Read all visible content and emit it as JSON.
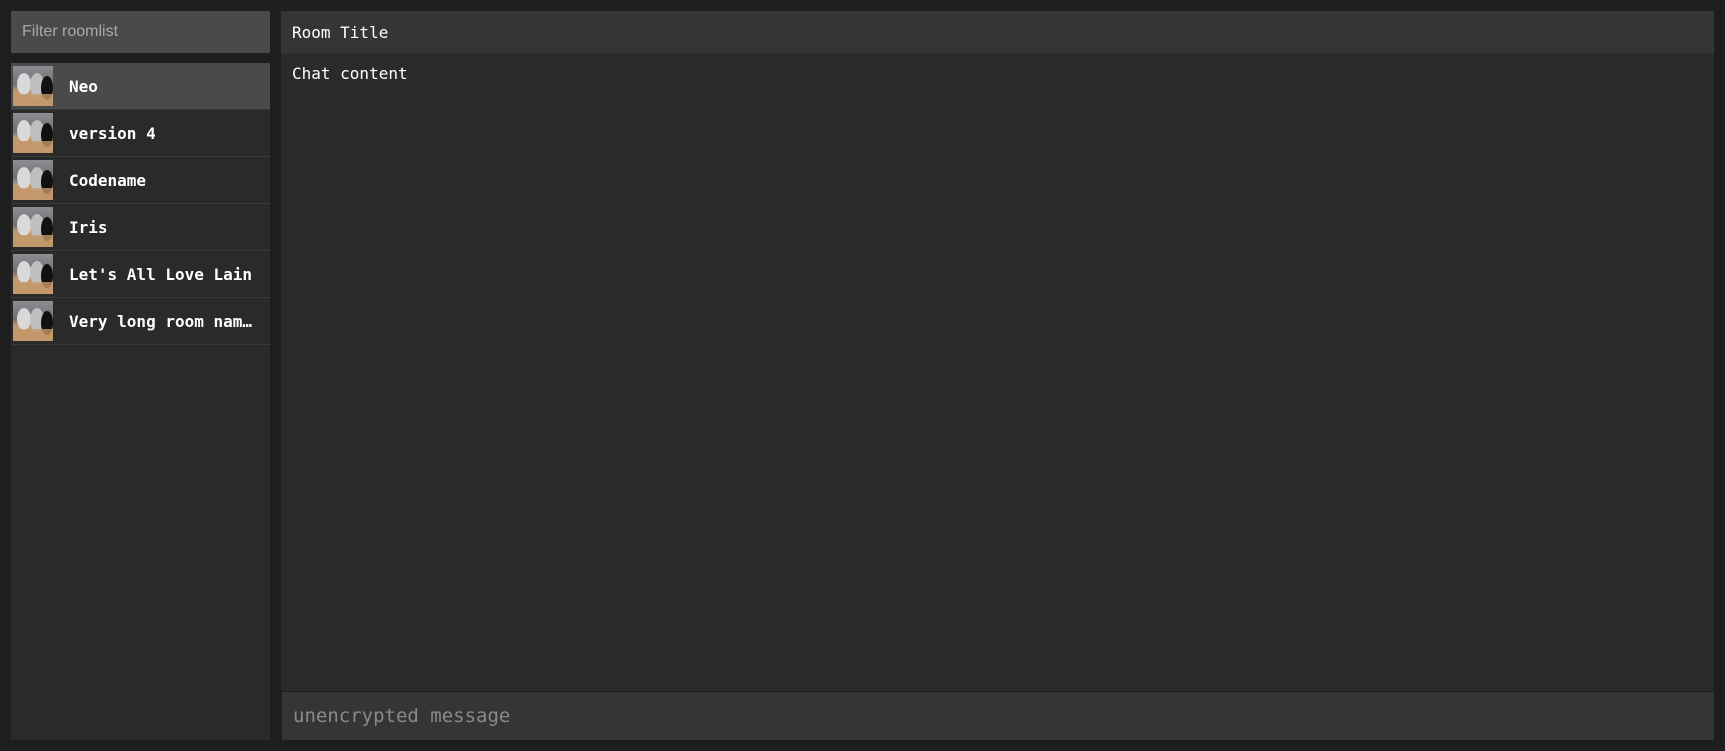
{
  "sidebar": {
    "filter_placeholder": "Filter roomlist",
    "rooms": [
      {
        "name": "Neo",
        "active": true
      },
      {
        "name": "version 4",
        "active": false
      },
      {
        "name": "Codename",
        "active": false
      },
      {
        "name": "Iris",
        "active": false
      },
      {
        "name": "Let's All Love Lain",
        "active": false
      },
      {
        "name": "Very long room nam…",
        "active": false
      }
    ],
    "avatar_icon": "room-avatar-icon"
  },
  "main": {
    "room_title": "Room Title",
    "chat_content": "Chat content",
    "composer_placeholder": "unencrypted message"
  },
  "colors": {
    "background": "#1e1e1e",
    "sidebar": "#2a2a2a",
    "active_room": "#4a4a4a",
    "header": "#353535",
    "chat": "#2b2b2b",
    "text": "#ffffff",
    "placeholder": "#8a8a8a"
  }
}
